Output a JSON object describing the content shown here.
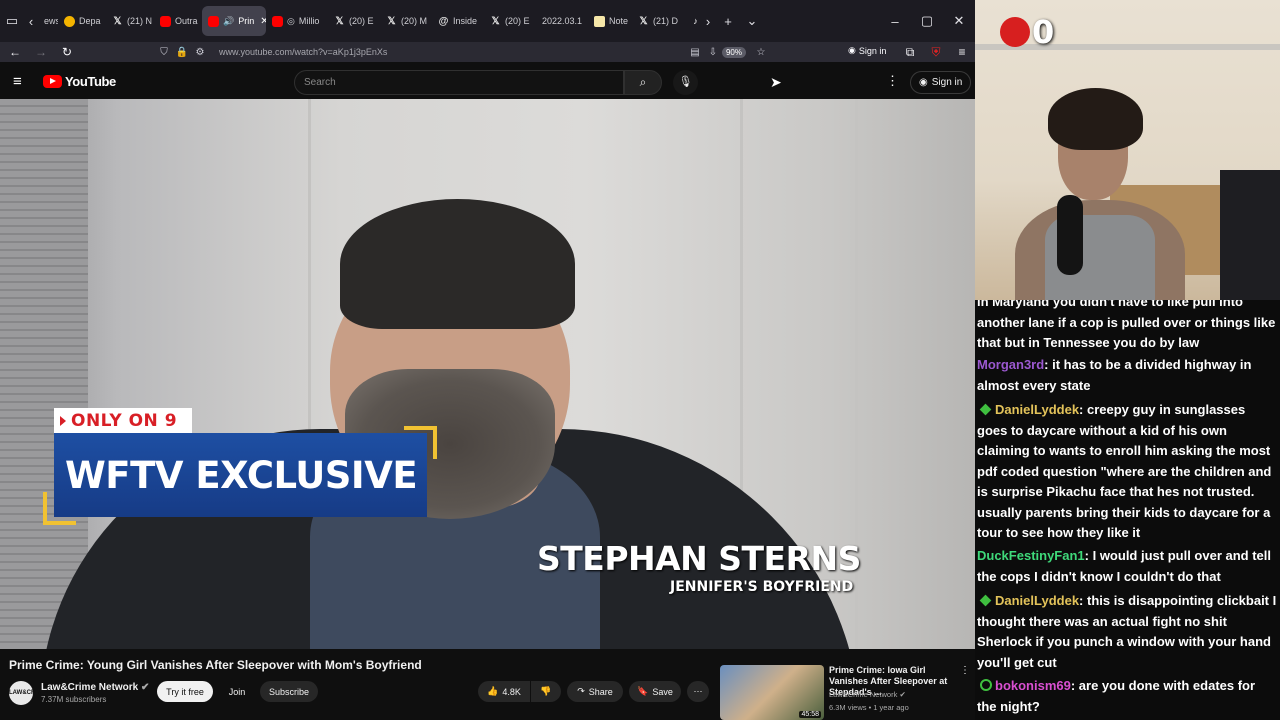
{
  "browser": {
    "tabs": [
      {
        "label": "ews",
        "icon": "nav-left-icon"
      },
      {
        "label": "Depa",
        "icon": "g-icon"
      },
      {
        "label": "(21) N",
        "icon": "x-icon"
      },
      {
        "label": "Outra",
        "icon": "youtube-icon"
      },
      {
        "label": "Prin",
        "icon": "youtube-icon",
        "active": true
      },
      {
        "label": "Millio",
        "icon": "youtube-icon"
      },
      {
        "label": "(20) E",
        "icon": "x-icon"
      },
      {
        "label": "(20) M",
        "icon": "x-icon"
      },
      {
        "label": "Inside",
        "icon": "g-icon"
      },
      {
        "label": "(20) E",
        "icon": "x-icon"
      },
      {
        "label": "2022.03.1",
        "icon": "none"
      },
      {
        "label": "Note",
        "icon": "note-icon"
      },
      {
        "label": "(21) D",
        "icon": "x-icon"
      }
    ],
    "url": "www.youtube.com/watch?v=aKp1j3pEnXs",
    "zoom": "90%",
    "signin": "Sign in"
  },
  "youtube": {
    "logo": "YouTube",
    "search_placeholder": "Search",
    "signin": "Sign in",
    "video": {
      "badge_top": "ONLY ON 9",
      "badge_main": "WFTV EXCLUSIVE",
      "lower_name": "STEPHAN STERNS",
      "lower_role": "JENNIFER'S BOYFRIEND"
    },
    "title": "Prime Crime: Young Girl Vanishes After Sleepover with Mom's Boyfriend",
    "channel": {
      "name": "Law&Crime Network",
      "subs": "7.37M subscribers",
      "avatar_text": "LAW&CRIME"
    },
    "actions": {
      "try": "Try it free",
      "join": "Join",
      "subscribe": "Subscribe",
      "likes": "4.8K",
      "share": "Share",
      "save": "Save"
    },
    "recommended": {
      "title": "Prime Crime: Iowa Girl Vanishes After Sleepover at Stepdad's ...",
      "channel": "Law&Crime Network",
      "meta": "6.3M views • 1 year ago",
      "duration": "45:58"
    }
  },
  "stream": {
    "counter": "0"
  },
  "chat": [
    {
      "user": "",
      "color": "#ffffff",
      "badge": false,
      "text": "in Maryland you didn't have to like pull into another lane if a cop is pulled over or things like that but in Tennessee you do by law"
    },
    {
      "user": "Morgan3rd",
      "color": "#9b59d0",
      "badge": false,
      "text": ": it has to be a divided highway in almost every state"
    },
    {
      "user": "DanielLyddek",
      "color": "#e3c35a",
      "badge": true,
      "text": ": creepy guy in sunglasses goes to daycare without a kid of his own claiming to wants to enroll him asking the most pdf coded question \"where are the children and is surprise Pikachu face that hes not trusted. usually parents bring their kids to daycare for a tour to see how they like it"
    },
    {
      "user": "DuckFestinyFan1",
      "color": "#3fd97a",
      "badge": false,
      "text": ": I would just pull over and tell the cops I didn't know I couldn't do that"
    },
    {
      "user": "DanielLyddek",
      "color": "#e3c35a",
      "badge": true,
      "text": ": this is disappointing clickbait I thought there was an actual fight no shit Sherlock if you punch a window with your hand you'll get cut"
    },
    {
      "user": "bokonism69",
      "color": "#d94fd1",
      "badge": "ring",
      "text": ": are you done with edates for the night?"
    }
  ]
}
